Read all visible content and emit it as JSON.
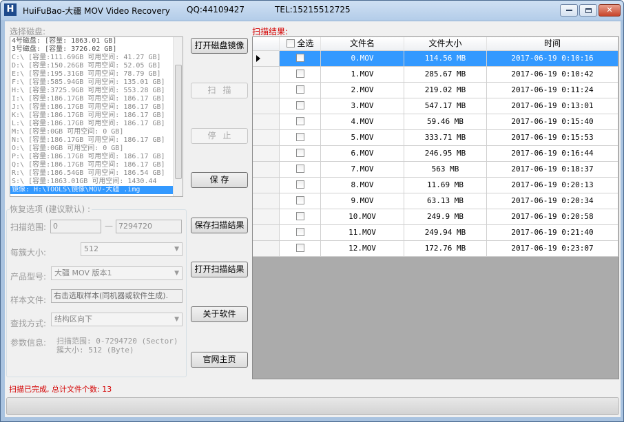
{
  "window": {
    "title": "HuiFuBao-大疆 MOV Video Recovery",
    "qq": "QQ:44109427",
    "tel": "TEL:15215512725",
    "icon_letter": "H",
    "controls": {
      "minimize": "▭",
      "maximize": "▭",
      "close": "✕"
    }
  },
  "disk_section": {
    "label": "选择磁盘:",
    "items": [
      "4号磁盘: [容量: 1863.01 GB]",
      "3号磁盘: [容量: 3726.02 GB]",
      "C:\\ [容量:111.69GB 可用空间: 41.27 GB]",
      "D:\\ [容量:150.26GB 可用空间: 52.05 GB]",
      "E:\\ [容量:195.31GB 可用空间: 78.79 GB]",
      "F:\\ [容量:585.94GB 可用空间: 135.01 GB]",
      "H:\\ [容量:3725.9GB 可用空间: 553.28 GB]",
      "I:\\ [容量:186.17GB 可用空间: 186.17 GB]",
      "J:\\ [容量:186.17GB 可用空间: 186.17 GB]",
      "K:\\ [容量:186.17GB 可用空间: 186.17 GB]",
      "L:\\ [容量:186.17GB 可用空间: 186.17 GB]",
      "M:\\ [容量:0GB 可用空间: 0 GB]",
      "N:\\ [容量:186.17GB 可用空间: 186.17 GB]",
      "O:\\ [容量:0GB 可用空间: 0 GB]",
      "P:\\ [容量:186.17GB 可用空间: 186.17 GB]",
      "Q:\\ [容量:186.17GB 可用空间: 186.17 GB]",
      "R:\\ [容量:186.54GB 可用空间: 186.54 GB]",
      "S:\\ [容量:1863.01GB 可用空间: 1430.44",
      "镜像: H:\\TOOLS\\镜像\\MOV-大疆 .img"
    ]
  },
  "options": {
    "group_label": "恢复选项 (建议默认) :",
    "scan_range_label": "扫描范围:",
    "scan_start": "0",
    "scan_dash": "—",
    "scan_end": "7294720",
    "cluster_label": "每簇大小:",
    "cluster_value": "512",
    "model_label": "产品型号:",
    "model_value": "大疆 MOV 版本1",
    "sample_label": "样本文件:",
    "sample_value": "右击选取样本(同机器或软件生成).",
    "search_label": "查找方式:",
    "search_value": "结构区向下",
    "params_label": "参数信息:",
    "params_line1": "扫描范围: 0-7294720 (Sector)",
    "params_line2": "簇大小: 512 (Byte)"
  },
  "buttons": {
    "open_image": "打开磁盘镜像",
    "scan": "扫描",
    "stop": "停止",
    "save": "保  存",
    "save_results": "保存扫描结果",
    "open_results": "打开扫描结果",
    "about": "关于软件",
    "homepage": "官网主页"
  },
  "results": {
    "label": "扫描结果:",
    "columns": {
      "select_all": "全选",
      "name": "文件名",
      "size": "文件大小",
      "time": "时间"
    },
    "rows": [
      {
        "name": "0.MOV",
        "size": "114.56 MB",
        "time": "2017-06-19 0:10:16"
      },
      {
        "name": "1.MOV",
        "size": "285.67 MB",
        "time": "2017-06-19 0:10:42"
      },
      {
        "name": "2.MOV",
        "size": "219.02 MB",
        "time": "2017-06-19 0:11:24"
      },
      {
        "name": "3.MOV",
        "size": "547.17 MB",
        "time": "2017-06-19 0:13:01"
      },
      {
        "name": "4.MOV",
        "size": "59.46 MB",
        "time": "2017-06-19 0:15:40"
      },
      {
        "name": "5.MOV",
        "size": "333.71 MB",
        "time": "2017-06-19 0:15:53"
      },
      {
        "name": "6.MOV",
        "size": "246.95 MB",
        "time": "2017-06-19 0:16:44"
      },
      {
        "name": "7.MOV",
        "size": "563 MB",
        "time": "2017-06-19 0:18:37"
      },
      {
        "name": "8.MOV",
        "size": "11.69 MB",
        "time": "2017-06-19 0:20:13"
      },
      {
        "name": "9.MOV",
        "size": "63.13 MB",
        "time": "2017-06-19 0:20:34"
      },
      {
        "name": "10.MOV",
        "size": "249.9 MB",
        "time": "2017-06-19 0:20:58"
      },
      {
        "name": "11.MOV",
        "size": "249.94 MB",
        "time": "2017-06-19 0:21:40"
      },
      {
        "name": "12.MOV",
        "size": "172.76 MB",
        "time": "2017-06-19 0:23:07"
      }
    ]
  },
  "status": {
    "message": "扫描已完成, 总计文件个数: 13"
  },
  "colors": {
    "selection": "#3399ff",
    "accent_red": "#d40000",
    "grid_bg": "#ababab"
  }
}
